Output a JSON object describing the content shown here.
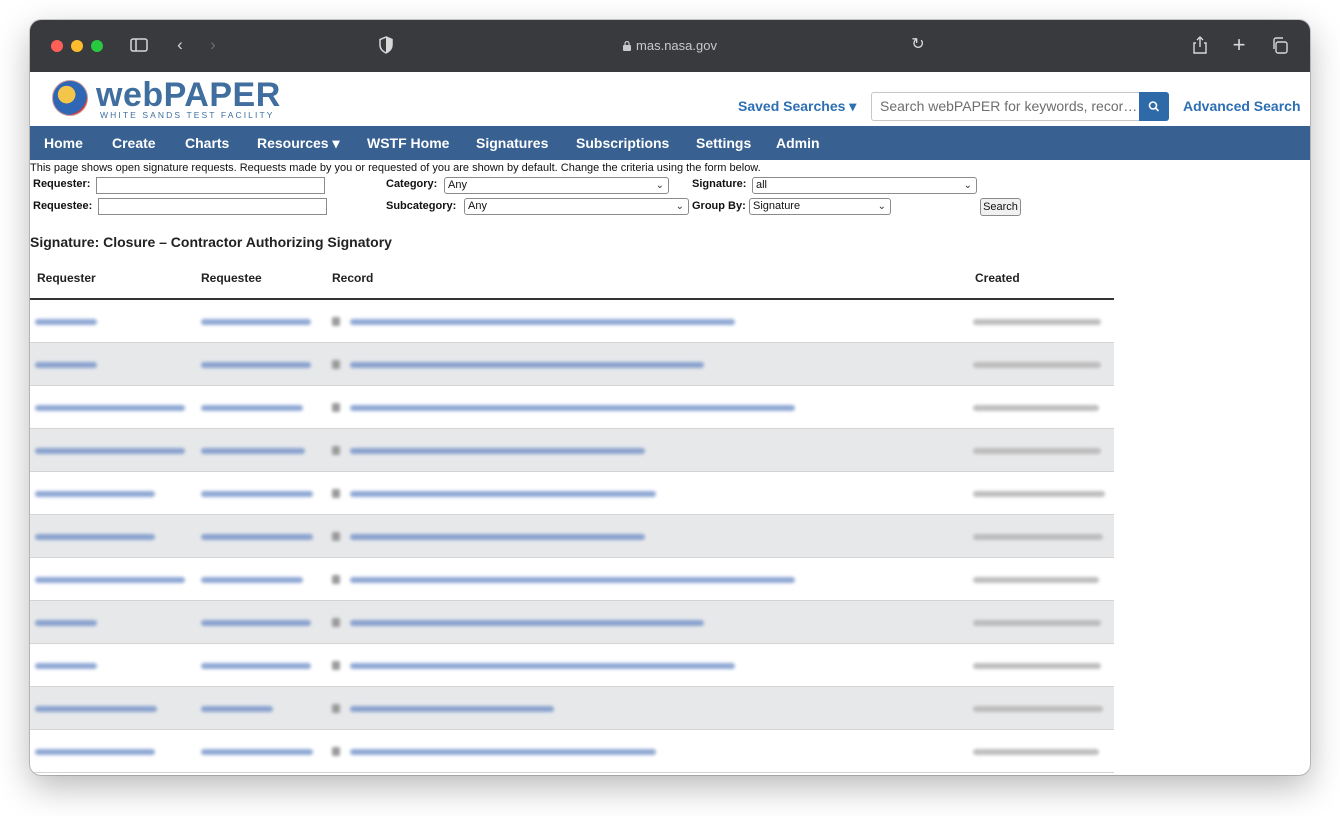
{
  "browser": {
    "url": "mas.nasa.gov"
  },
  "header": {
    "brand_web": "web",
    "brand_paper": "PAPER",
    "brand_subtitle": "WHITE SANDS TEST FACILITY",
    "saved_searches": "Saved Searches ▾",
    "search_placeholder": "Search webPAPER for keywords, recor…",
    "advanced_search": "Advanced Search"
  },
  "nav": {
    "items": [
      "Home",
      "Create",
      "Charts",
      "Resources ▾",
      "WSTF Home",
      "Signatures",
      "Subscriptions",
      "Settings",
      "Admin"
    ]
  },
  "form": {
    "intro": "This page shows open signature requests. Requests made by you or requested of you are shown by default. Change the criteria using the form below.",
    "requester_label": "Requester:",
    "requestee_label": "Requestee:",
    "category_label": "Category:",
    "category_value": "Any",
    "subcategory_label": "Subcategory:",
    "subcategory_value": "Any",
    "signature_label": "Signature:",
    "signature_value": "all",
    "groupby_label": "Group By:",
    "groupby_value": "Signature",
    "search_button": "Search"
  },
  "results": {
    "section_title": "Signature: Closure – Contractor Authorizing Signatory",
    "columns": [
      "Requester",
      "Requestee",
      "Record",
      "Created"
    ],
    "row_count_visible": 11
  },
  "colors": {
    "nav_bg": "#386192",
    "link": "#2d6fb3",
    "titlebar": "#383a3e"
  }
}
